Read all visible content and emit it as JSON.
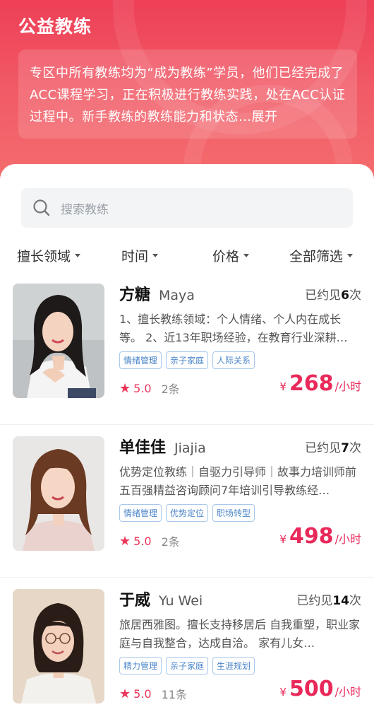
{
  "header": {
    "title": "公益教练",
    "intro_text": "专区中所有教练均为“成为教练”学员，他们已经完成了ACC课程学习，正在积极进行教练实践，处在ACC认证过程中。新手教练的教练能力和状态…",
    "expand_label": "展开"
  },
  "search": {
    "placeholder": "搜索教练"
  },
  "filters": [
    {
      "label": "擅长领域"
    },
    {
      "label": "时间"
    },
    {
      "label": "价格"
    },
    {
      "label": "全部筛选"
    }
  ],
  "coaches": [
    {
      "name": "方糖",
      "english_name": "Maya",
      "met_prefix": "已约见",
      "met_count": "6",
      "met_suffix": "次",
      "description": "1、擅长教练领域：个人情绪、个人内在成长等。 2、近13年职场经验，在教育行业深耕…",
      "tags": [
        "情绪管理",
        "亲子家庭",
        "人际关系"
      ],
      "score": "5.0",
      "reviews": "2条",
      "currency": "¥",
      "price": "268",
      "unit": "/小时"
    },
    {
      "name": "单佳佳",
      "english_name": "Jiajia",
      "met_prefix": "已约见",
      "met_count": "7",
      "met_suffix": "次",
      "description": "优势定位教练｜自驱力引导师｜故事力培训师前五百强精益咨询顾问7年培训引导教练经…",
      "tags": [
        "情绪管理",
        "优势定位",
        "职场转型"
      ],
      "score": "5.0",
      "reviews": "2条",
      "currency": "¥",
      "price": "498",
      "unit": "/小时"
    },
    {
      "name": "于威",
      "english_name": "Yu Wei",
      "met_prefix": "已约见",
      "met_count": "14",
      "met_suffix": "次",
      "description": "旅居西雅图。擅长支持移居后 自我重塑，职业家庭与自我整合，达成自洽。 家有儿女…",
      "tags": [
        "精力管理",
        "亲子家庭",
        "生涯规划"
      ],
      "score": "5.0",
      "reviews": "11条",
      "currency": "¥",
      "price": "500",
      "unit": "/小时"
    }
  ]
}
